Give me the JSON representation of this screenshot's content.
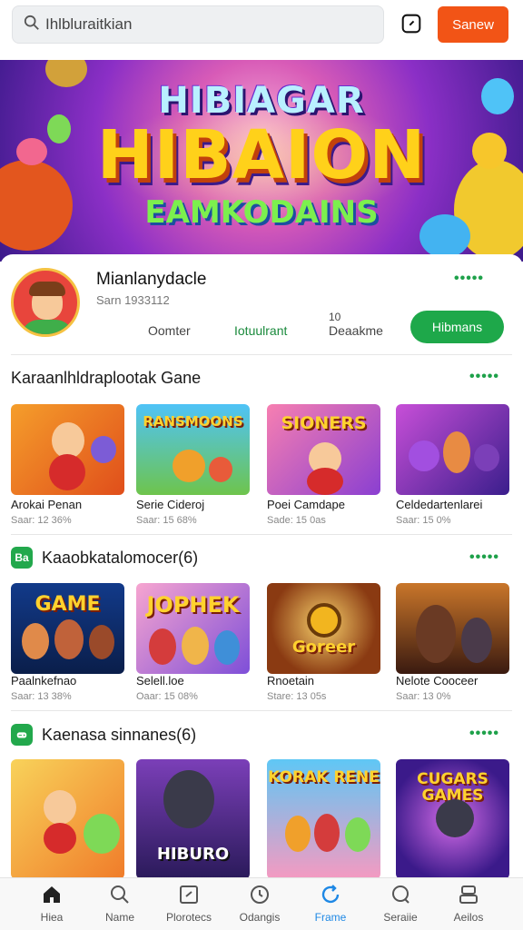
{
  "search": {
    "value": "Ihlbluraitkian"
  },
  "header": {
    "action_label": "Sanew"
  },
  "banner": {
    "line1": "HIBIAGAR",
    "line2": "HIBAION",
    "line3": "EAMKODAINS"
  },
  "profile": {
    "name": "Mianlanydacle",
    "subtitle": "Sarn 1933112",
    "stats": [
      "Oomter",
      "Iotuulrant",
      "Deaakme"
    ],
    "stat_extra": "10",
    "follow_label": "Hibmans",
    "dots": "•••••"
  },
  "sections": [
    {
      "title": "Karaanlhldraplootak Gane",
      "badge": "",
      "dots": "•••••",
      "games": [
        {
          "tile_text": "",
          "title": "Arokai Penan",
          "sub": "Saar: 12 36%"
        },
        {
          "tile_text": "RANSMOONS",
          "title": "Serie Cideroj",
          "sub": "Saar: 15 68%"
        },
        {
          "tile_text": "SIONERS",
          "title": "Poei Camdape",
          "sub": "Sade: 15 0as"
        },
        {
          "tile_text": "",
          "title": "Celdedartenlarei",
          "sub": "Saar: 15 0%"
        }
      ]
    },
    {
      "title": "Kaaobkatalomocer(6)",
      "badge": "Ba",
      "dots": "•••••",
      "games": [
        {
          "tile_text": "GAME",
          "title": "Paalnkefnao",
          "sub": "Saar: 13 38%"
        },
        {
          "tile_text": "JOPHEK",
          "title": "Selell.loe",
          "sub": "Oaar: 15 08%"
        },
        {
          "tile_text": "Goreer",
          "title": "Rnoetain",
          "sub": "Stare: 13 05s"
        },
        {
          "tile_text": "",
          "title": "Nelote Cooceer",
          "sub": "Saar: 13 0%"
        }
      ]
    },
    {
      "title": "Kaenasa sinnanes(6)",
      "badge": "",
      "dots": "•••••",
      "games": [
        {
          "tile_text": "",
          "title": "",
          "sub": ""
        },
        {
          "tile_text": "HIBURO",
          "title": "",
          "sub": ""
        },
        {
          "tile_text": "KORAK RENE",
          "title": "",
          "sub": ""
        },
        {
          "tile_text": "CUGARS GAMES",
          "title": "",
          "sub": ""
        }
      ]
    }
  ],
  "nav": [
    {
      "label": "Hiea",
      "icon": "home-icon"
    },
    {
      "label": "Name",
      "icon": "search-icon"
    },
    {
      "label": "Plorotecs",
      "icon": "library-icon"
    },
    {
      "label": "Odangis",
      "icon": "clock-icon"
    },
    {
      "label": "Frame",
      "icon": "refresh-icon",
      "active": true
    },
    {
      "label": "Seraiie",
      "icon": "chat-icon"
    },
    {
      "label": "Aeilos",
      "icon": "profile-icon"
    }
  ],
  "colors": {
    "accent_orange": "#f25416",
    "accent_green": "#1ea84a",
    "nav_active": "#1e88e5"
  }
}
